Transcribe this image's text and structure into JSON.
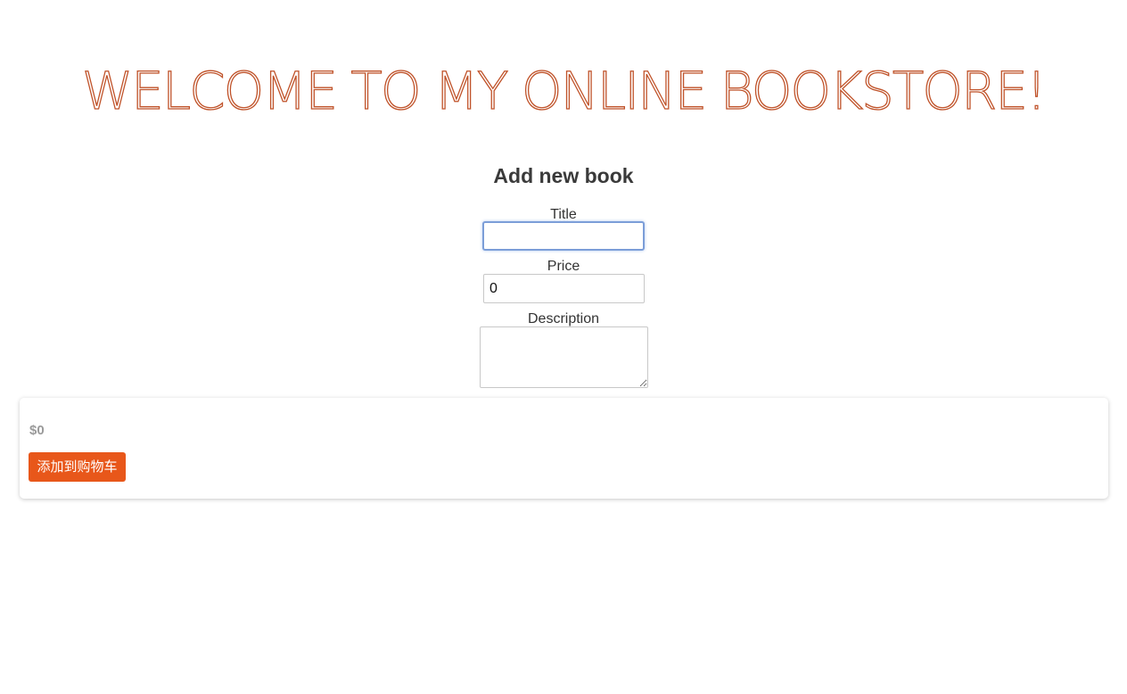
{
  "header": {
    "welcome_text": "WELCOME TO MY ONLINE BOOKSTORE!",
    "accent_color": "#c0532a"
  },
  "form": {
    "heading": "Add new book",
    "title_label": "Title",
    "title_value": "",
    "price_label": "Price",
    "price_value": "0",
    "description_label": "Description",
    "description_value": ""
  },
  "book_card": {
    "price": "$0",
    "add_to_cart_label": "添加到购物车",
    "button_color": "#e8571a"
  }
}
